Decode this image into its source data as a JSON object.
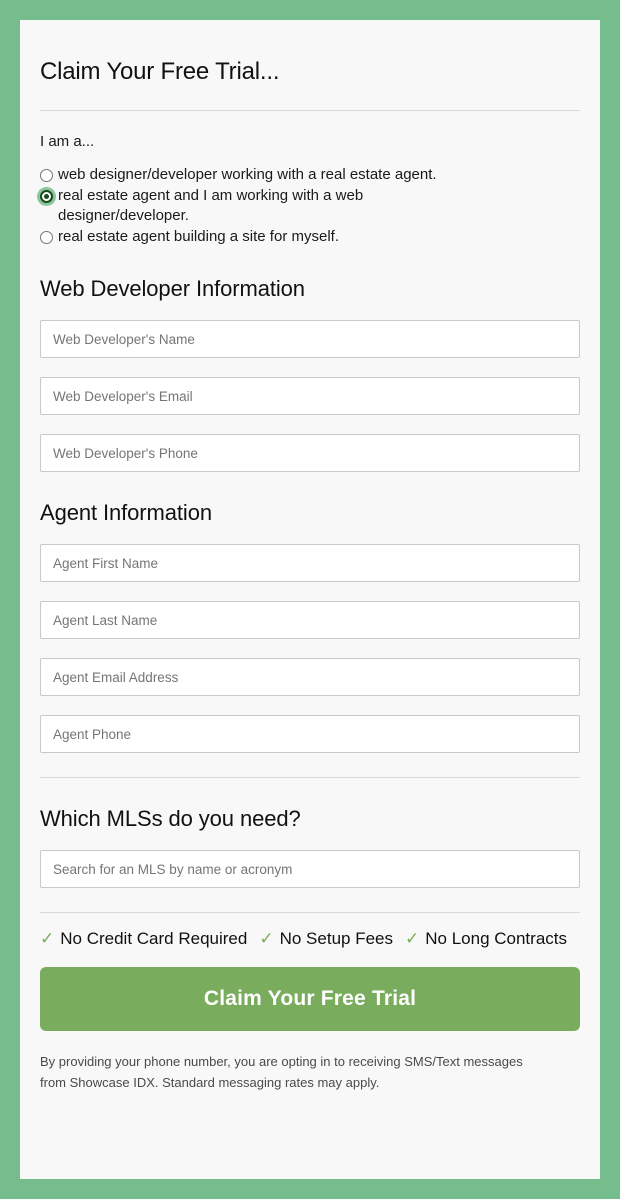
{
  "theme": {
    "page_border_green": "#76bd8d",
    "card_background": "#f8f8f8",
    "accent_green": "#7aac5e",
    "check_green": "#7aac5e",
    "field_border": "#c9c9c9",
    "divider": "#d8d8d8"
  },
  "form": {
    "title": "Claim Your Free Trial...",
    "role_question": {
      "label": "I am a...",
      "options": [
        {
          "label": "web designer/developer working with a real estate agent.",
          "selected": false
        },
        {
          "label": "real estate agent and I am working with a web designer/developer.",
          "selected": true
        },
        {
          "label": "real estate agent building a site for myself.",
          "selected": false
        }
      ]
    },
    "web_developer_section": {
      "heading": "Web Developer Information",
      "fields": [
        {
          "name": "web-developer-name",
          "placeholder": "Web Developer's Name",
          "value": ""
        },
        {
          "name": "web-developer-email",
          "placeholder": "Web Developer's Email",
          "value": ""
        },
        {
          "name": "web-developer-phone",
          "placeholder": "Web Developer's Phone",
          "value": ""
        }
      ]
    },
    "agent_section": {
      "heading": "Agent Information",
      "fields": [
        {
          "name": "agent-first-name",
          "placeholder": "Agent First Name",
          "value": ""
        },
        {
          "name": "agent-last-name",
          "placeholder": "Agent Last Name",
          "value": ""
        },
        {
          "name": "agent-email-address",
          "placeholder": "Agent Email Address",
          "value": ""
        },
        {
          "name": "agent-phone",
          "placeholder": "Agent Phone",
          "value": ""
        }
      ]
    },
    "mls_section": {
      "heading": "Which MLSs do you need?",
      "search_placeholder": "Search for an MLS by name or acronym",
      "search_value": ""
    },
    "features": [
      {
        "icon": "check-icon",
        "label": "No Credit Card Required"
      },
      {
        "icon": "check-icon",
        "label": "No Setup Fees"
      },
      {
        "icon": "check-icon",
        "label": "No Long Contracts"
      }
    ],
    "submit_label": "Claim Your Free Trial",
    "disclaimer": "By providing your phone number, you are opting in to receiving SMS/Text messages from Showcase IDX. Standard messaging rates may apply."
  }
}
